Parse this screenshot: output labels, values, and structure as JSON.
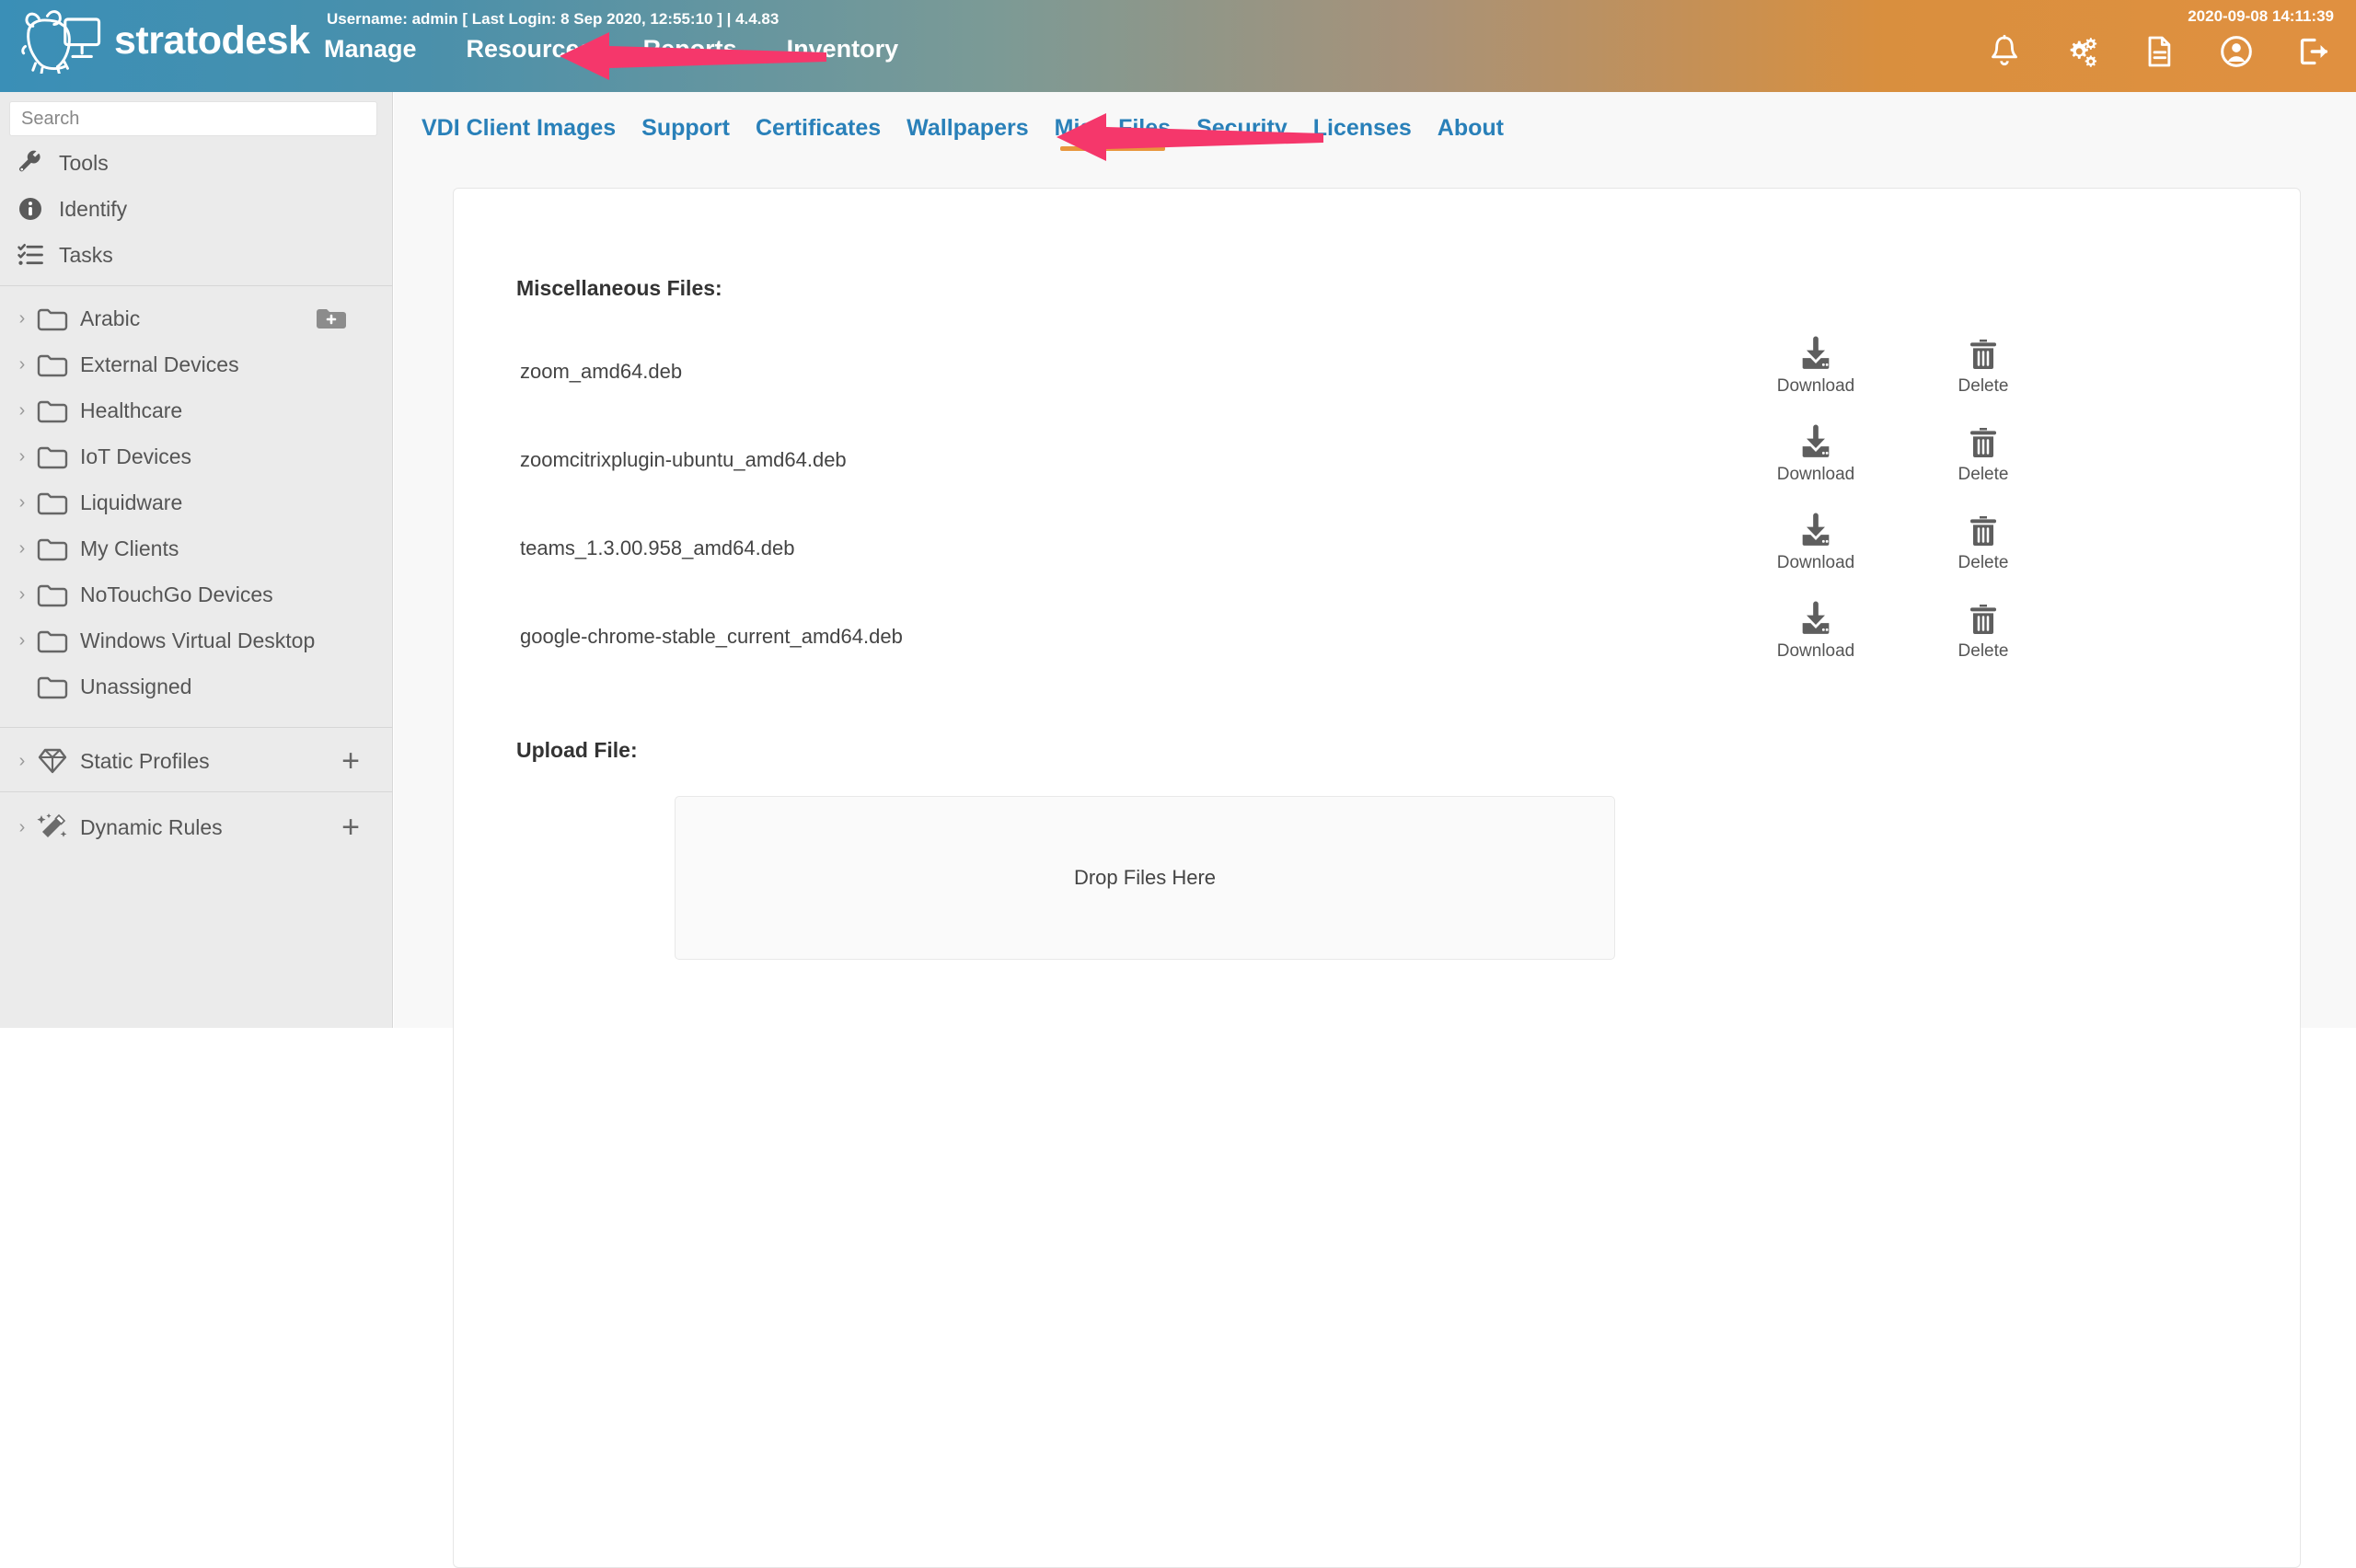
{
  "header": {
    "brand": "stratodesk",
    "brand_logo_icon": "bear-monitor-logo-icon",
    "user_info": "Username: admin [ Last Login: 8 Sep 2020, 12:55:10 ]  |  4.4.83",
    "datetime": "2020-09-08 14:11:39",
    "gradient_start": "#3a8fb7",
    "gradient_end": "#e09040",
    "nav": [
      {
        "label": "Manage",
        "name": "nav-manage"
      },
      {
        "label": "Resources",
        "name": "nav-resources"
      },
      {
        "label": "Reports",
        "name": "nav-reports"
      },
      {
        "label": "Inventory",
        "name": "nav-inventory"
      }
    ],
    "icons": [
      {
        "name": "bell-icon",
        "title": "Notifications"
      },
      {
        "name": "gears-icon",
        "title": "Settings"
      },
      {
        "name": "document-icon",
        "title": "Logs"
      },
      {
        "name": "user-account-icon",
        "title": "Account"
      },
      {
        "name": "logout-icon",
        "title": "Log out"
      }
    ]
  },
  "sidebar": {
    "search": {
      "placeholder": "Search",
      "value": ""
    },
    "quick_links": [
      {
        "label": "Tools",
        "icon": "wrench-icon"
      },
      {
        "label": "Identify",
        "icon": "info-circle-icon"
      },
      {
        "label": "Tasks",
        "icon": "checklist-icon"
      }
    ],
    "tree": [
      {
        "label": "Arabic",
        "expandable": true,
        "has_add_folder": true
      },
      {
        "label": "External Devices",
        "expandable": true,
        "has_add_folder": false
      },
      {
        "label": "Healthcare",
        "expandable": true,
        "has_add_folder": false
      },
      {
        "label": "IoT Devices",
        "expandable": true,
        "has_add_folder": false
      },
      {
        "label": "Liquidware",
        "expandable": true,
        "has_add_folder": false
      },
      {
        "label": "My Clients",
        "expandable": true,
        "has_add_folder": false
      },
      {
        "label": "NoTouchGo Devices",
        "expandable": true,
        "has_add_folder": false
      },
      {
        "label": "Windows Virtual Desktop",
        "expandable": true,
        "has_add_folder": false
      },
      {
        "label": "Unassigned",
        "expandable": false,
        "has_add_folder": false
      }
    ],
    "sections": [
      {
        "label": "Static Profiles",
        "icon": "diamond-icon",
        "add_label": "+"
      },
      {
        "label": "Dynamic Rules",
        "icon": "magic-wand-icon",
        "add_label": "+"
      }
    ],
    "caret": "›"
  },
  "subnav": {
    "active_accent": "#e8963c",
    "link_color": "#2980b9",
    "tabs": [
      {
        "label": "VDI Client Images",
        "active": false
      },
      {
        "label": "Support",
        "active": false
      },
      {
        "label": "Certificates",
        "active": false
      },
      {
        "label": "Wallpapers",
        "active": false
      },
      {
        "label": "Misc. Files",
        "active": true
      },
      {
        "label": "Security",
        "active": false
      },
      {
        "label": "Licenses",
        "active": false
      },
      {
        "label": "About",
        "active": false
      }
    ]
  },
  "main": {
    "files_heading": "Miscellaneous Files:",
    "upload_heading": "Upload File:",
    "download_label": "Download",
    "delete_label": "Delete",
    "download_icon": "download-icon",
    "delete_icon": "trash-icon",
    "files": [
      {
        "name": "zoom_amd64.deb"
      },
      {
        "name": "zoomcitrixplugin-ubuntu_amd64.deb"
      },
      {
        "name": "teams_1.3.00.958_amd64.deb"
      },
      {
        "name": "google-chrome-stable_current_amd64.deb"
      }
    ],
    "dropzone_text": "Drop Files Here"
  },
  "annotations": {
    "color": "#f5376b",
    "arrows": [
      {
        "name": "annotation-arrow-top-nav",
        "points_to": "Resources"
      },
      {
        "name": "annotation-arrow-subnav",
        "points_to": "Misc. Files"
      }
    ]
  }
}
